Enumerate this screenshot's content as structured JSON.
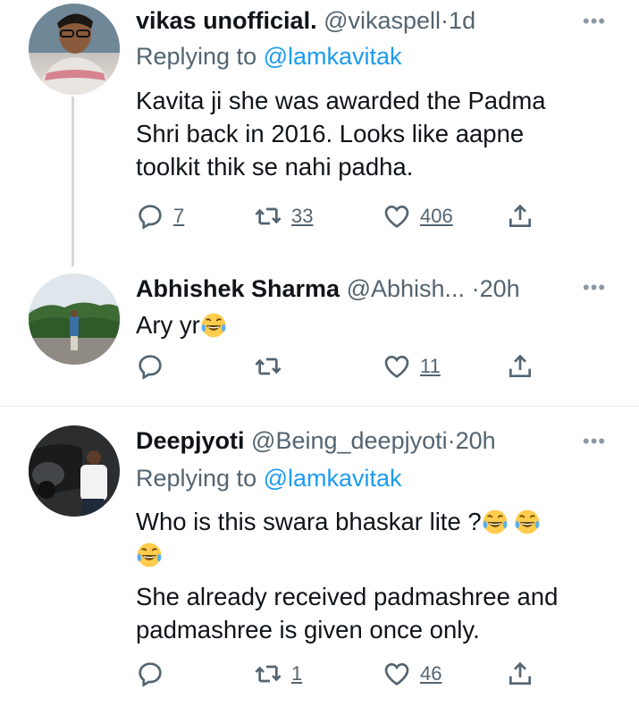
{
  "tweets": [
    {
      "name": "vikas unofficial.",
      "handle": "@vikaspell",
      "time": "1d",
      "replying_prefix": "Replying to",
      "replying_to": "@lamkavitak",
      "text_lines": [
        "Kavita ji she was awarded the Padma",
        "Shri back in 2016. Looks like aapne",
        "toolkit thik se nahi padha."
      ],
      "replies": "7",
      "retweets": "33",
      "likes": "406",
      "avatar_icon": "avatar-photo"
    },
    {
      "name": "Abhishek Sharma",
      "handle": "@Abhish...",
      "time": "20h",
      "text": "Ary yr",
      "emoji": "laughing-tears-emoji",
      "replies": "",
      "retweets": "",
      "likes": "11",
      "avatar_icon": "avatar-photo"
    },
    {
      "name": "Deepjyoti",
      "handle": "@Being_deepjyoti",
      "time": "20h",
      "replying_prefix": "Replying to",
      "replying_to": "@lamkavitak",
      "text_line1": "Who is this swara bhaskar lite ?",
      "text_line3": "She already received padmashree and",
      "text_line4": "padmashree is given once only.",
      "replies": "",
      "retweets": "1",
      "likes": "46",
      "avatar_icon": "avatar-photo"
    }
  ],
  "dot": "·",
  "more_icon": "more-options-icon",
  "colors": {
    "text": "#0f1419",
    "secondary": "#536471",
    "link": "#1d9bf0",
    "divider": "#e6ecf0"
  }
}
